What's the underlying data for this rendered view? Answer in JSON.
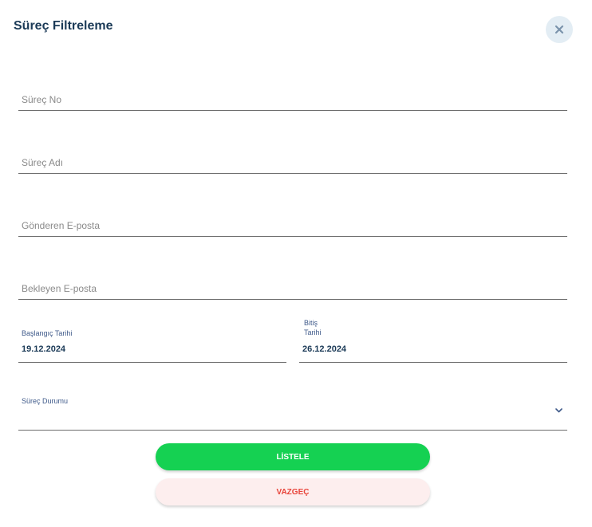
{
  "dialog": {
    "title": "Süreç Filtreleme"
  },
  "fields": {
    "process_no": {
      "placeholder": "Süreç No",
      "value": ""
    },
    "process_name": {
      "placeholder": "Süreç Adı",
      "value": ""
    },
    "sender_email": {
      "placeholder": "Gönderen E-posta",
      "value": ""
    },
    "pending_email": {
      "placeholder": "Bekleyen E-posta",
      "value": ""
    },
    "start_date": {
      "label": "Başlangıç Tarihi",
      "value": "19.12.2024"
    },
    "end_date": {
      "label_line1": "Bitiş",
      "label_line2": "Tarihi",
      "value": "26.12.2024"
    },
    "status": {
      "label": "Süreç Durumu",
      "value": ""
    }
  },
  "buttons": {
    "list_label": "LİSTELE",
    "cancel_label": "VAZGEÇ"
  },
  "icons": {
    "close": "close-icon",
    "dropdown": "chevron-down-icon"
  },
  "colors": {
    "title": "#1b3a57",
    "primary": "#15d152",
    "cancel_text": "#e8443a",
    "cancel_bg": "#fdeeee"
  }
}
